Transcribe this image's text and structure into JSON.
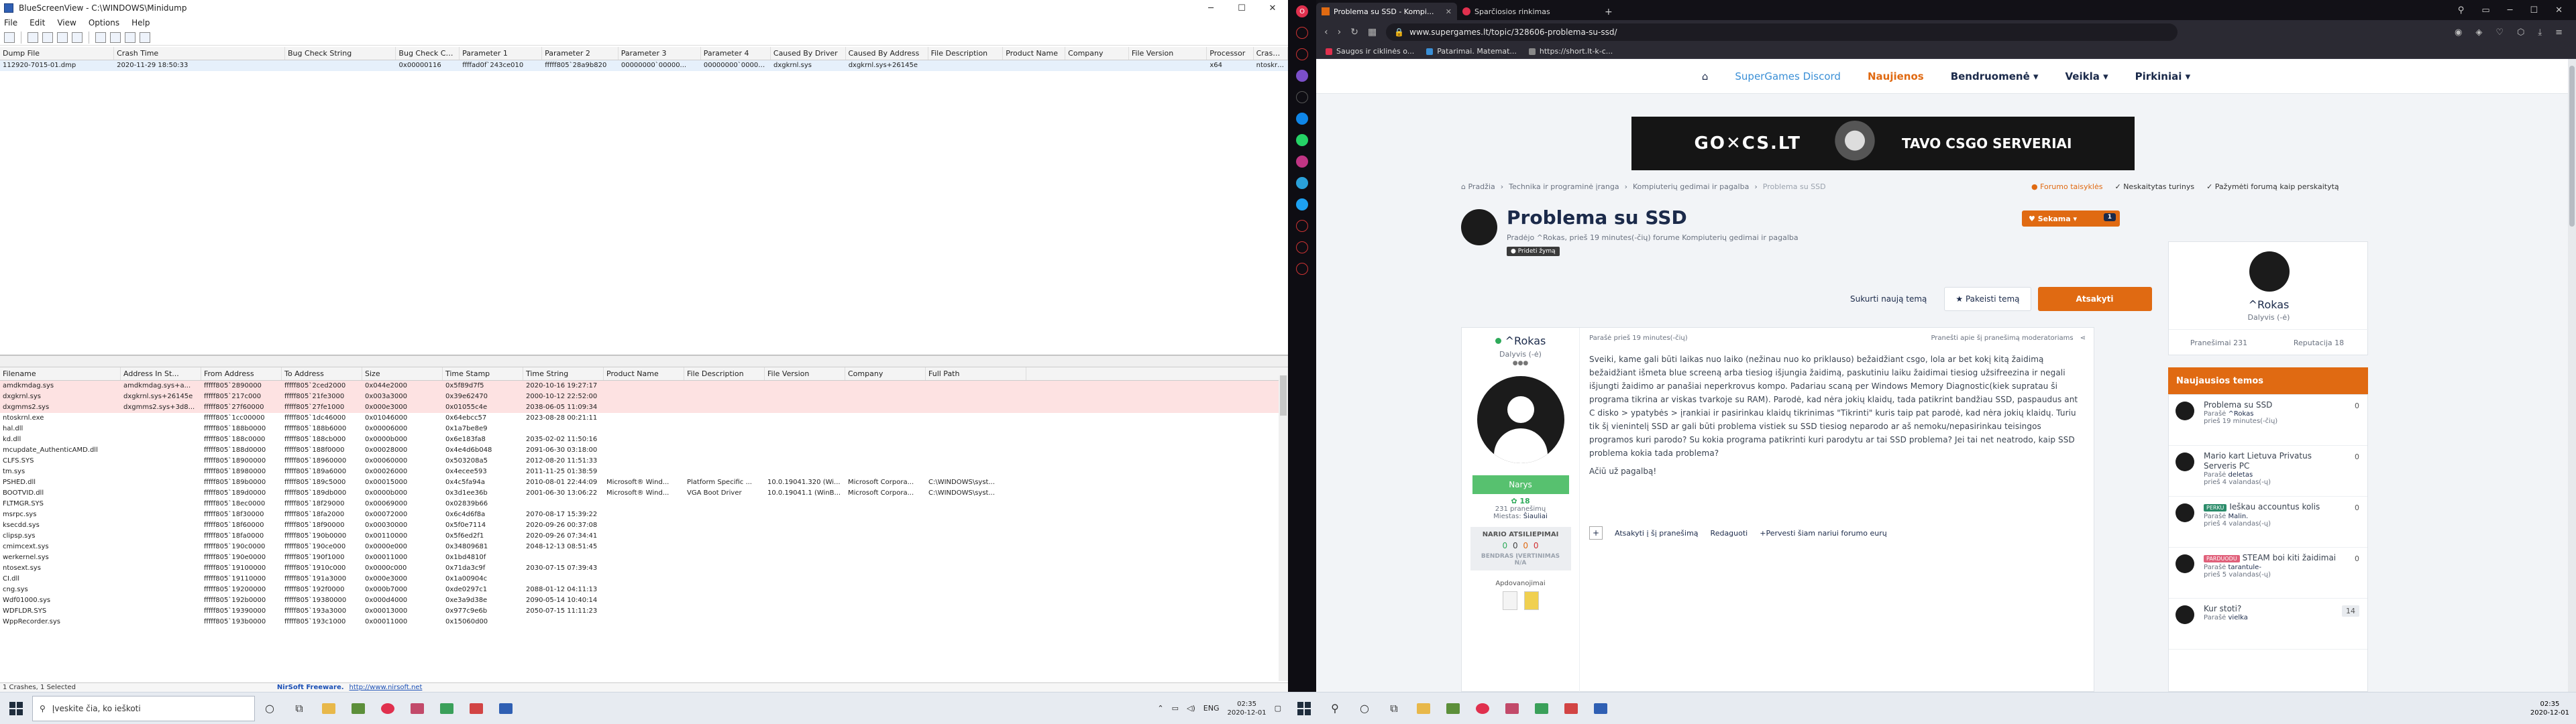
{
  "left": {
    "window": {
      "title": "BlueScreenView  -  C:\\WINDOWS\\Minidump",
      "menu": [
        "File",
        "Edit",
        "View",
        "Options",
        "Help"
      ]
    },
    "dumps": {
      "columns": [
        "Dump File",
        "Crash Time",
        "Bug Check String",
        "Bug Check Code",
        "Parameter 1",
        "Parameter 2",
        "Parameter 3",
        "Parameter 4",
        "Caused By Driver",
        "Caused By Address",
        "File Description",
        "Product Name",
        "Company",
        "File Version",
        "Processor",
        "Crash Ad"
      ],
      "rows": [
        [
          "112920-7015-01.dmp",
          "2020-11-29 18:50:33",
          "",
          "0x00000116",
          "ffffad0f`243ce010",
          "fffff805`28a9b820",
          "00000000`00000...",
          "00000000`00000...",
          "dxgkrnl.sys",
          "dxgkrnl.sys+26145e",
          "",
          "",
          "",
          "",
          "x64",
          "ntoskrnl.e"
        ]
      ]
    },
    "drivers": {
      "columns": [
        "Filename",
        "Address In St...",
        "From Address",
        "To Address",
        "Size",
        "Time Stamp",
        "Time String",
        "Product Name",
        "File Description",
        "File Version",
        "Company",
        "Full Path"
      ],
      "rows": [
        {
          "hl": true,
          "c": [
            "amdkmdag.sys",
            "amdkmdag.sys+a...",
            "fffff805`2890000",
            "fffff805`2ced2000",
            "0x044e2000",
            "0x5f89d7f5",
            "2020-10-16 19:27:17",
            "",
            "",
            "",
            "",
            ""
          ]
        },
        {
          "hl": true,
          "c": [
            "dxgkrnl.sys",
            "dxgkrnl.sys+26145e",
            "fffff805`217c000",
            "fffff805`21fe3000",
            "0x003a3000",
            "0x39e62470",
            "2000-10-12 22:52:00",
            "",
            "",
            "",
            "",
            ""
          ]
        },
        {
          "hl": true,
          "c": [
            "dxgmms2.sys",
            "dxgmms2.sys+3d8...",
            "fffff805`27f60000",
            "fffff805`27fe1000",
            "0x000e3000",
            "0x01055c4e",
            "2038-06-05 11:09:34",
            "",
            "",
            "",
            "",
            ""
          ]
        },
        {
          "hl": false,
          "c": [
            "ntoskrnl.exe",
            "",
            "fffff805`1cc00000",
            "fffff805`1dc46000",
            "0x01046000",
            "0x64ebcc57",
            "2023-08-28 00:21:11",
            "",
            "",
            "",
            "",
            ""
          ]
        },
        {
          "hl": false,
          "c": [
            "hal.dll",
            "",
            "fffff805`188b0000",
            "fffff805`188b6000",
            "0x00006000",
            "0x1a7be8e9",
            "",
            "",
            "",
            "",
            "",
            ""
          ]
        },
        {
          "hl": false,
          "c": [
            "kd.dll",
            "",
            "fffff805`188c0000",
            "fffff805`188cb000",
            "0x0000b000",
            "0x6e183fa8",
            "2035-02-02 11:50:16",
            "",
            "",
            "",
            "",
            ""
          ]
        },
        {
          "hl": false,
          "c": [
            "mcupdate_AuthenticAMD.dll",
            "",
            "fffff805`188d0000",
            "fffff805`188f0000",
            "0x00028000",
            "0x4e4d6b048",
            "2091-06-30 03:18:00",
            "",
            "",
            "",
            "",
            ""
          ]
        },
        {
          "hl": false,
          "c": [
            "CLFS.SYS",
            "",
            "fffff805`18900000",
            "fffff805`18960000",
            "0x00060000",
            "0x503208a5",
            "2012-08-20 11:51:33",
            "",
            "",
            "",
            "",
            ""
          ]
        },
        {
          "hl": false,
          "c": [
            "tm.sys",
            "",
            "fffff805`18980000",
            "fffff805`189a6000",
            "0x00026000",
            "0x4ecee593",
            "2011-11-25 01:38:59",
            "",
            "",
            "",
            "",
            ""
          ]
        },
        {
          "hl": false,
          "c": [
            "PSHED.dll",
            "",
            "fffff805`189b0000",
            "fffff805`189c5000",
            "0x00015000",
            "0x4c5fa94a",
            "2010-08-01 22:44:09",
            "Microsoft® Wind...",
            "Platform Specific ...",
            "10.0.19041.320 (Wi...",
            "Microsoft Corpora...",
            "C:\\WINDOWS\\syst..."
          ]
        },
        {
          "hl": false,
          "c": [
            "BOOTVID.dll",
            "",
            "fffff805`189d0000",
            "fffff805`189db000",
            "0x0000b000",
            "0x3d1ee36b",
            "2001-06-30 13:06:22",
            "Microsoft® Wind...",
            "VGA Boot Driver",
            "10.0.19041.1 (WinB...",
            "Microsoft Corpora...",
            "C:\\WINDOWS\\syst..."
          ]
        },
        {
          "hl": false,
          "c": [
            "FLTMGR.SYS",
            "",
            "fffff805`18ec0000",
            "fffff805`18f29000",
            "0x00069000",
            "0x02839b66",
            "",
            "",
            "",
            "",
            "",
            ""
          ]
        },
        {
          "hl": false,
          "c": [
            "msrpc.sys",
            "",
            "fffff805`18f30000",
            "fffff805`18fa2000",
            "0x00072000",
            "0x6c4d6f8a",
            "2070-08-17 15:39:22",
            "",
            "",
            "",
            "",
            ""
          ]
        },
        {
          "hl": false,
          "c": [
            "ksecdd.sys",
            "",
            "fffff805`18f60000",
            "fffff805`18f90000",
            "0x00030000",
            "0x5f0e7114",
            "2020-09-26 00:37:08",
            "",
            "",
            "",
            "",
            ""
          ]
        },
        {
          "hl": false,
          "c": [
            "clipsp.sys",
            "",
            "fffff805`18fa0000",
            "fffff805`190b0000",
            "0x00110000",
            "0x5f6ed2f1",
            "2020-09-26 07:34:41",
            "",
            "",
            "",
            "",
            ""
          ]
        },
        {
          "hl": false,
          "c": [
            "cmimcext.sys",
            "",
            "fffff805`190c0000",
            "fffff805`190ce000",
            "0x0000e000",
            "0x34809681",
            "2048-12-13 08:51:45",
            "",
            "",
            "",
            "",
            ""
          ]
        },
        {
          "hl": false,
          "c": [
            "werkernel.sys",
            "",
            "fffff805`190e0000",
            "fffff805`190f1000",
            "0x00011000",
            "0x1bd4810f",
            "",
            "",
            "",
            "",
            "",
            ""
          ]
        },
        {
          "hl": false,
          "c": [
            "ntosext.sys",
            "",
            "fffff805`19100000",
            "fffff805`1910c000",
            "0x0000c000",
            "0x71da3c9f",
            "2030-07-15 07:39:43",
            "",
            "",
            "",
            "",
            ""
          ]
        },
        {
          "hl": false,
          "c": [
            "CI.dll",
            "",
            "fffff805`19110000",
            "fffff805`191a3000",
            "0x000e3000",
            "0x1a00904c",
            "",
            "",
            "",
            "",
            "",
            ""
          ]
        },
        {
          "hl": false,
          "c": [
            "cng.sys",
            "",
            "fffff805`19200000",
            "fffff805`192f0000",
            "0x000b7000",
            "0xde0297c1",
            "2088-01-12 04:11:13",
            "",
            "",
            "",
            "",
            ""
          ]
        },
        {
          "hl": false,
          "c": [
            "Wdf01000.sys",
            "",
            "fffff805`192b0000",
            "fffff805`19380000",
            "0x000d4000",
            "0xe3a9d38e",
            "2090-05-14 10:40:14",
            "",
            "",
            "",
            "",
            ""
          ]
        },
        {
          "hl": false,
          "c": [
            "WDFLDR.SYS",
            "",
            "fffff805`19390000",
            "fffff805`193a3000",
            "0x00013000",
            "0x977c9e6b",
            "2050-07-15 11:11:23",
            "",
            "",
            "",
            "",
            ""
          ]
        },
        {
          "hl": false,
          "c": [
            "WppRecorder.sys",
            "",
            "fffff805`193b0000",
            "fffff805`193c1000",
            "0x00011000",
            "0x15060d00",
            "",
            "",
            "",
            "",
            "",
            ""
          ]
        }
      ]
    },
    "status": {
      "left": "1 Crashes, 1 Selected",
      "credit": "NirSoft Freeware.",
      "url": "http://www.nirsoft.net"
    },
    "taskbar": {
      "search_placeholder": "Įveskite čia, ko ieškoti",
      "lang": "ENG",
      "time": "02:35",
      "date": "2020-12-01"
    }
  },
  "right": {
    "browser": {
      "tabs": [
        {
          "label": "Problema su SSD - Kompi...",
          "active": true
        },
        {
          "label": "Sparčiosios rinkimas",
          "active": false
        }
      ],
      "url": "www.supergames.lt/topic/328606-problema-su-ssd/",
      "bookmarks": [
        "Saugos ir ciklinės o...",
        "Patarimai. Matemat...",
        "https://short.lt-k-c..."
      ]
    },
    "site": {
      "nav": [
        {
          "label": "SuperGames Discord",
          "style": "blue"
        },
        {
          "label": "Naujienos",
          "style": "active"
        },
        {
          "label": "Bendruomenė ▾",
          "style": "dd"
        },
        {
          "label": "Veikla ▾",
          "style": "dd"
        },
        {
          "label": "Pirkiniai ▾",
          "style": "dd"
        }
      ],
      "banner_logo": "GO✕CS.LT",
      "banner_text": "TAVO CSGO SERVERIAI",
      "breadcrumbs": [
        "⌂ Pradžia",
        "›",
        "Technika ir programinė įranga",
        "›",
        "Kompiuterių gedimai ir pagalba",
        "›",
        "Problema su SSD"
      ],
      "toplinks": [
        "● Forumo taisyklės",
        "✓ Neskaitytas turinys",
        "✓ Pažymėti forumą kaip perskaitytą"
      ],
      "topic": {
        "title": "Problema su SSD",
        "meta": "Pradėjo ^Rokas, prieš 19 minutes(-čių) forume Kompiuterių gedimai ir pagalba",
        "tag": "● Prideti žymą"
      },
      "follow_label": "♥ Sekama ▾",
      "follow_count": "1",
      "actions": {
        "follow": "Sukurti naują temą",
        "reply_topic": "★ Pakeisti temą",
        "answer": "Atsakyti"
      },
      "post": {
        "author": "^Rokas",
        "author_status": "Dalyvis (-ė)",
        "stars": "●●●",
        "rank": "Narys",
        "rep": "✿ 18",
        "posts": "231 pranešimų",
        "city_label": "Miestas:",
        "city": "Šiauliai",
        "rating_head": "NARIO ATSILIEPIMAI",
        "rating_dots": [
          "0",
          "0",
          "0",
          "0"
        ],
        "rating_foot": "BENDRAS ĮVERTINIMAS N/A",
        "badges_head": "Apdovanojimai",
        "time": "Parašė prieš 19 minutes(-čių)",
        "report": "Pranešti apie šį pranešimą moderatoriams",
        "body": "Sveiki, kame gali būti laikas nuo laiko (nežinau nuo ko priklauso) bežaidžiant csgo, lola ar bet kokį kitą žaidimą bežaidžiant išmeta blue screeną arba tiesiog išjungia žaidimą, paskutiniu laiku žaidimai tiesiog užsifreezina ir negali išjungti žaidimo ar panašiai neperkrovus kompo. Padariau scaną per Windows Memory Diagnostic(kiek supratau ši programa tikrina ar viskas tvarkoje su RAM). Parodė, kad nėra jokių klaidų, tada patikrint bandžiau SSD, paspaudus ant C disko > ypatybės > įrankiai ir pasirinkau klaidų tikrinimas \"Tikrinti\" kuris taip pat parodė, kad nėra jokių klaidų. Turiu tik šį vienintelį SSD ar gali būti problema vistiek su SSD tiesiog neparodo ar aš nemoku/nepasirinkau teisingos programos kuri parodo? Su kokia programa patikrinti kuri parodytu ar tai SSD problema? Jei tai net neatrodo, kaip SSD problema kokia tada problema?",
        "body2": "Ačiū už pagalbą!",
        "foot": [
          "Atsakyti į šį pranešimą",
          "Redaguoti",
          "+Pervesti šiam nariui forumo eurų"
        ]
      },
      "side_card": {
        "name": "^Rokas",
        "status": "Dalyvis (-ė)",
        "posts": "Pranešimai 231",
        "rep": "Reputacija 18"
      },
      "newtopics_title": "Naujausios temos",
      "newtopics": [
        {
          "title": "Problema su SSD",
          "by_label": "Parašė",
          "by": "^Rokas",
          "when": "prieš 19 minutes(-čių)",
          "count": "0",
          "pill": "",
          "pill_color": ""
        },
        {
          "title": "Mario kart Lietuva Privatus Serveris PC",
          "by_label": "Parašė",
          "by": "deletas",
          "when": "prieš 4 valandas(-ų)",
          "count": "0",
          "pill": "",
          "pill_color": ""
        },
        {
          "title": "Ieškau accountus kolis",
          "by_label": "Parašė",
          "by": "Malin.",
          "when": "prieš 4 valandas(-ų)",
          "count": "0",
          "pill": "PERKU",
          "pill_color": "#2b8c6a"
        },
        {
          "title": "STEAM boi kiti žaidimai",
          "by_label": "Parašė",
          "by": "tarantule-",
          "when": "prieš 5 valandas(-ų)",
          "count": "0",
          "pill": "PARDUODU",
          "pill_color": "#e0607a"
        },
        {
          "title": "Kur stoti?",
          "by_label": "Parašė",
          "by": "vielka",
          "when": "",
          "count": "14",
          "pill": "",
          "pill_color": ""
        }
      ]
    },
    "taskbar": {
      "time": "02:35",
      "date": "2020-12-01"
    }
  }
}
